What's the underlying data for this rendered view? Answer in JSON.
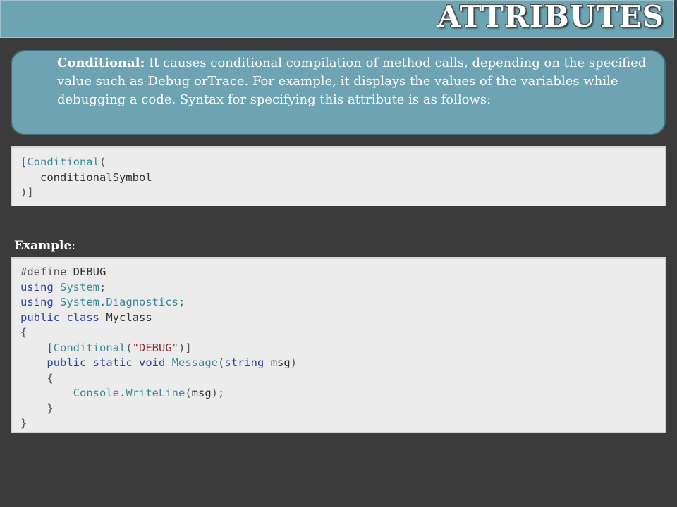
{
  "slide": {
    "title": "ATTRIBUTES",
    "definition": {
      "term": "Conditional",
      "colon": ":",
      "text": " It causes conditional  compilation of method calls, depending on the specified value such as Debug orTrace. For example, it displays the values of the variables while debugging a code. Syntax for specifying this attribute is as follows:"
    },
    "syntax_lines": [
      "[Conditional(",
      "   conditionalSymbol",
      ")]"
    ],
    "example_label": "Example",
    "example_colon": ":",
    "example_lines": [
      "#define DEBUG",
      "using System;",
      "using System.Diagnostics;",
      "public class Myclass",
      "{",
      "    [Conditional(\"DEBUG\")]",
      "    public static void Message(string msg)",
      "    {",
      "        Console.WriteLine(msg);",
      "    }",
      "}"
    ]
  },
  "colors": {
    "background": "#3b3b3b",
    "title_bar": "#6da4b2",
    "definition_box": "#6ea3b3",
    "code_background": "#ececec",
    "keyword": "#2b45a8",
    "type": "#3a8a9a",
    "string": "#8b2a2a"
  }
}
